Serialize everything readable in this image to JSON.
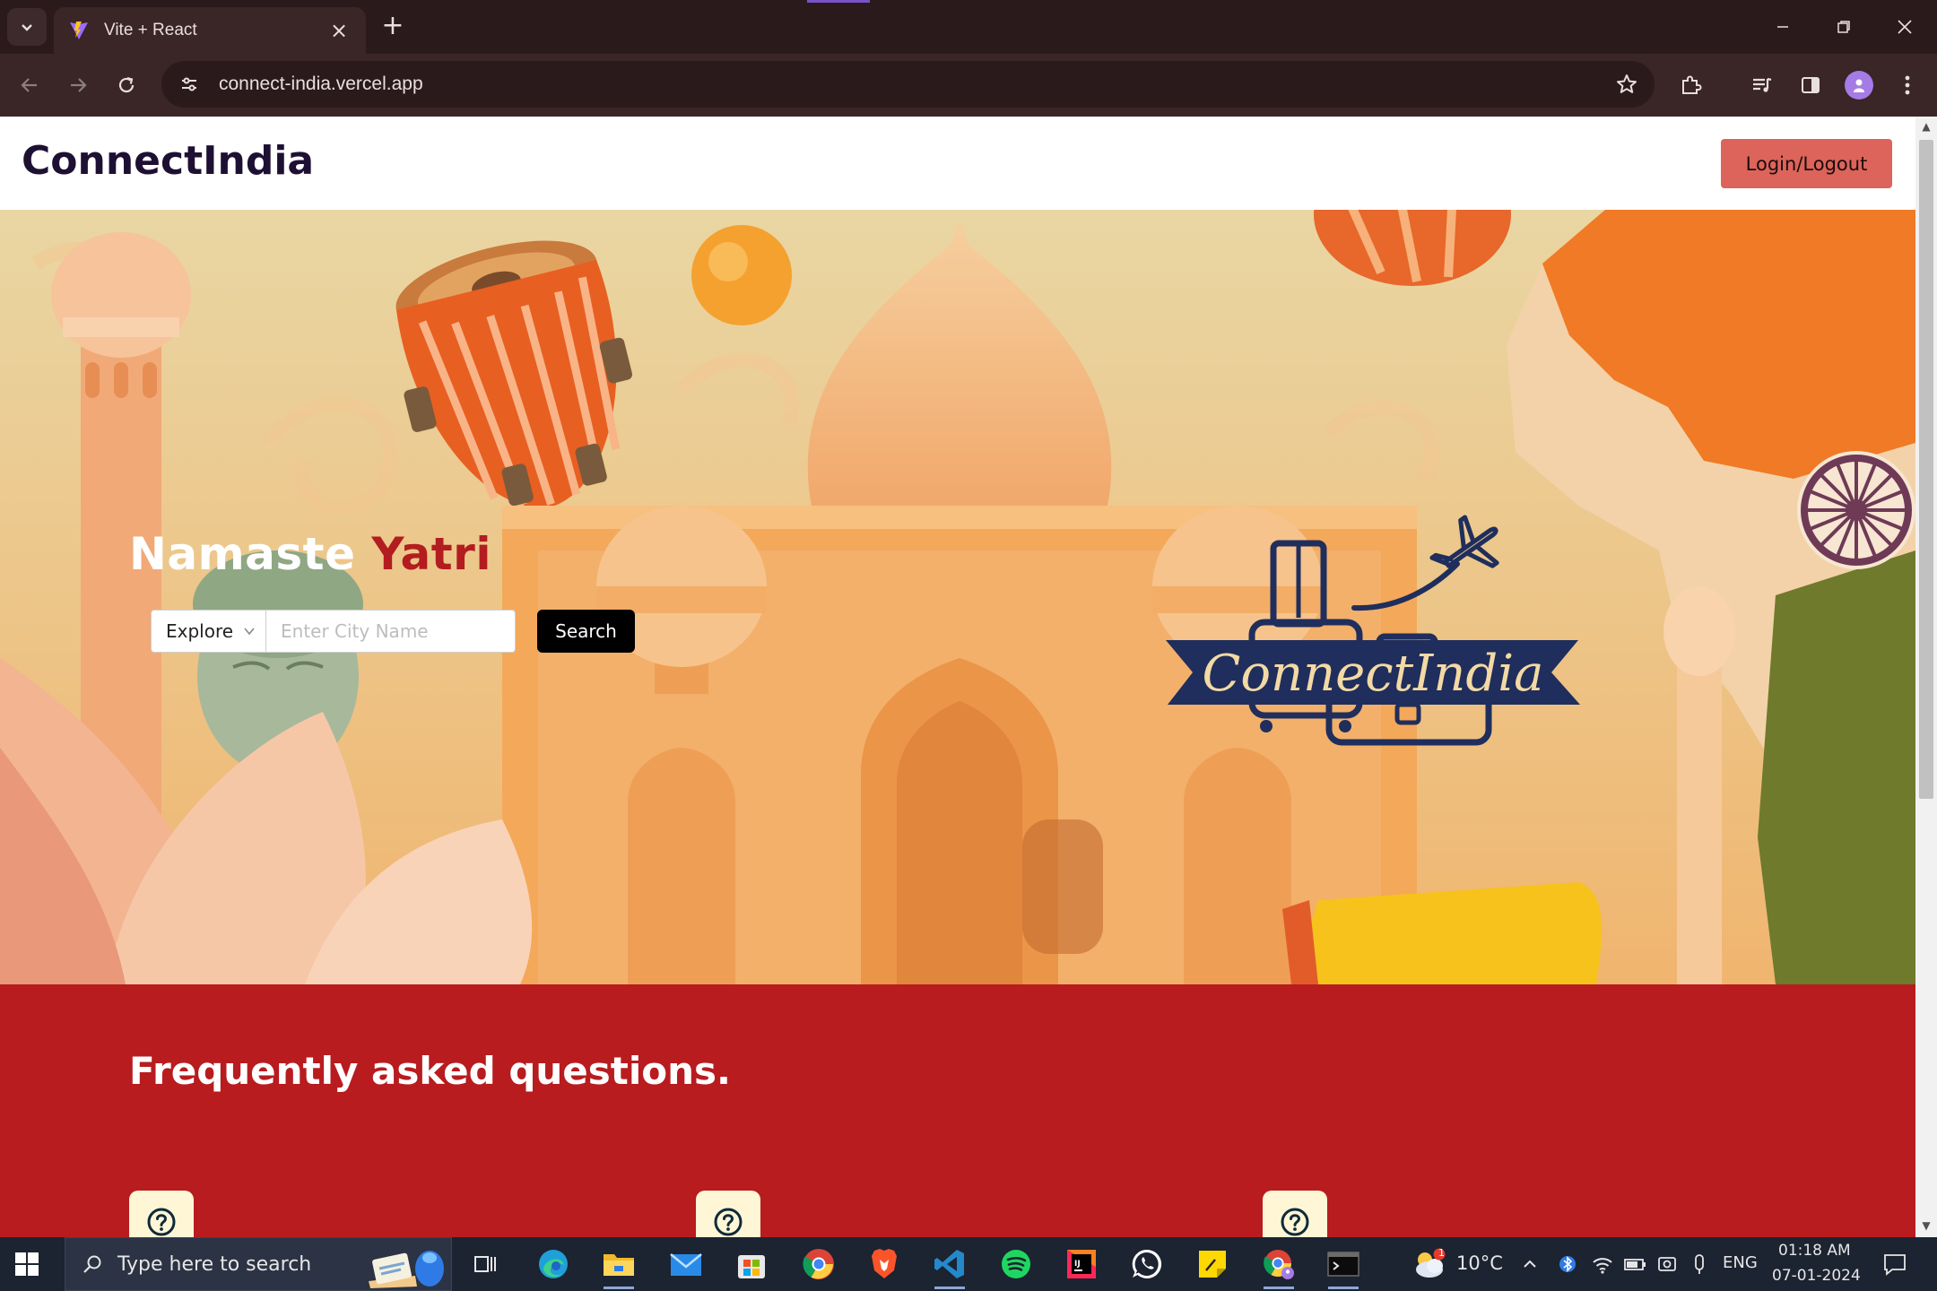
{
  "browser": {
    "tab_title": "Vite + React",
    "url": "connect-india.vercel.app"
  },
  "site": {
    "brand": "ConnectIndia",
    "login_label": "Login/Logout",
    "greeting_part1": "Namaste ",
    "greeting_part2": "Yatri",
    "explore_label": "Explore",
    "city_placeholder": "Enter City Name",
    "search_label": "Search",
    "logo_text": "ConnectIndia",
    "faq_title": "Frequently asked questions."
  },
  "taskbar": {
    "search_placeholder": "Type here to search",
    "temperature": "10°C",
    "language": "ENG",
    "time": "01:18 AM",
    "date": "07-01-2024",
    "weather_badge": "1"
  },
  "colors": {
    "accent": "#b31d1f",
    "login_button": "#dc645a",
    "faq_background": "#b81c1f",
    "brand_text": "#1e1033",
    "logo_navy": "#1f2e5c",
    "logo_gold": "#f3d9a4"
  }
}
